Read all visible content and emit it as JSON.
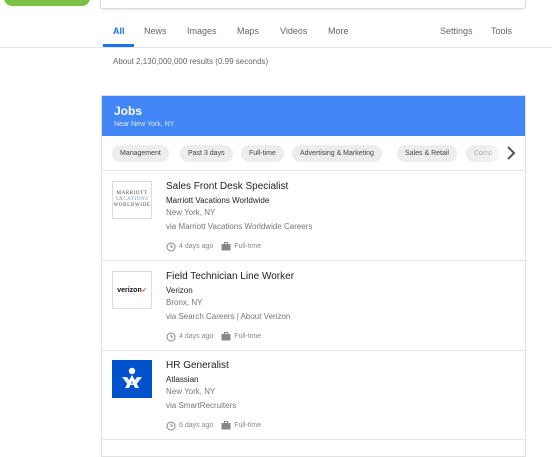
{
  "nav": {
    "items": [
      "All",
      "News",
      "Images",
      "Maps",
      "Videos",
      "More"
    ],
    "active": "All",
    "right_items": [
      "Settings",
      "Tools"
    ]
  },
  "result_stats": "About 2,130,000,000 results (0.99 seconds)",
  "jobs": {
    "title": "Jobs",
    "subtitle": "Near New York, NY",
    "chips": [
      "Management",
      "Past 3 days",
      "Full-time",
      "Advertising & Marketing",
      "Sales & Retail",
      "Comp"
    ],
    "listings": [
      {
        "title": "Sales Front Desk Specialist",
        "company": "Marriott Vacations Worldwide",
        "location": "New York, NY",
        "via": "via Marriott Vacations Worldwide Careers",
        "posted": "4 days ago",
        "type": "Full-time",
        "logo": {
          "line1": "MARRIOTT",
          "line2": "VACATIONS",
          "line3": "WORLDWIDE"
        }
      },
      {
        "title": "Field Technician Line Worker",
        "company": "Verizon",
        "location": "Bronx, NY",
        "via": "via Search Careers | About Verizon",
        "posted": "4 days ago",
        "type": "Full-time",
        "logo": {
          "text": "verizon",
          "mark": "✓"
        }
      },
      {
        "title": "HR Generalist",
        "company": "Atlassian",
        "location": "New York, NY",
        "via": "via SmartRecruiters",
        "posted": "6 days ago",
        "type": "Full-time"
      }
    ]
  },
  "colors": {
    "accent": "#1a73e8",
    "jobs_header": "#4285f4",
    "logo_green": "#7ac143",
    "atlassian_blue": "#0052cc",
    "verizon_red": "#d52b1e"
  },
  "icons": {
    "clock": "clock-icon",
    "briefcase": "briefcase-icon",
    "next": "chevron-right-icon"
  }
}
